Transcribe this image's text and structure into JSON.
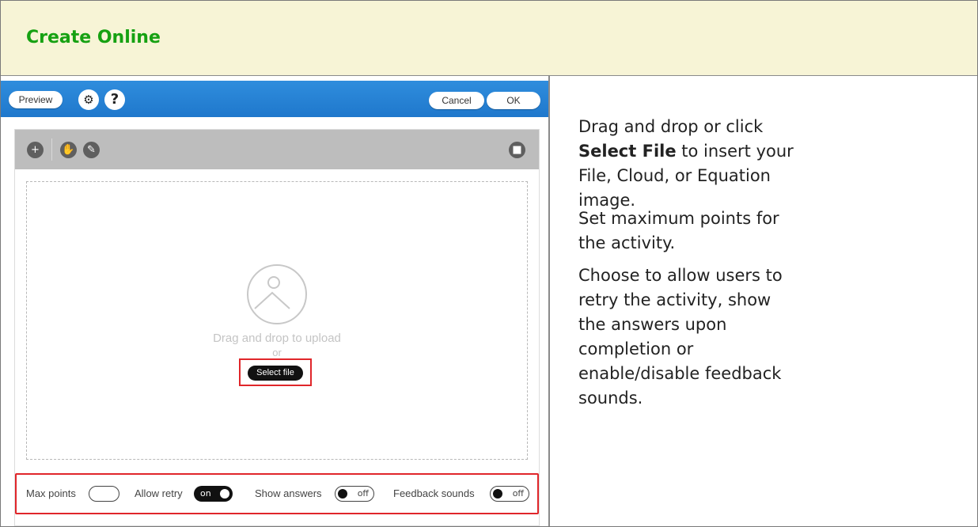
{
  "header": {
    "title": "Create Online"
  },
  "editor": {
    "preview_label": "Preview",
    "help_glyph": "?",
    "cancel_label": "Cancel",
    "ok_label": "OK",
    "icons": [
      "settings-gear-icon",
      "help-icon",
      "add-icon",
      "hand-icon",
      "pencil-icon",
      "trash-icon"
    ],
    "dropzone": {
      "main_text": "Drag and drop to upload",
      "or_text": "or",
      "select_label": "Select file"
    },
    "settings": {
      "max_points_label": "Max points",
      "allow_retry_label": "Allow retry",
      "allow_retry_state": "on",
      "show_answers_label": "Show answers",
      "show_answers_state": "off",
      "feedback_sounds_label": "Feedback sounds",
      "feedback_sounds_state": "off"
    },
    "colors": {
      "topbar": "#1f78cc",
      "highlight": "#e0262a",
      "toolbar": "#bdbdbd"
    }
  },
  "instructions": {
    "p1_pre": "Drag and drop or click ",
    "p1_bold": "Select File",
    "p1_post": " to insert your File, Cloud, or Equation image.",
    "p2": "Set maximum points for the activity.",
    "p3": "Choose to allow users to retry the activity, show the answers upon completion or enable/disable feedback sounds."
  },
  "colors": {
    "header_bg": "#f7f4d6",
    "title": "#16a112"
  }
}
